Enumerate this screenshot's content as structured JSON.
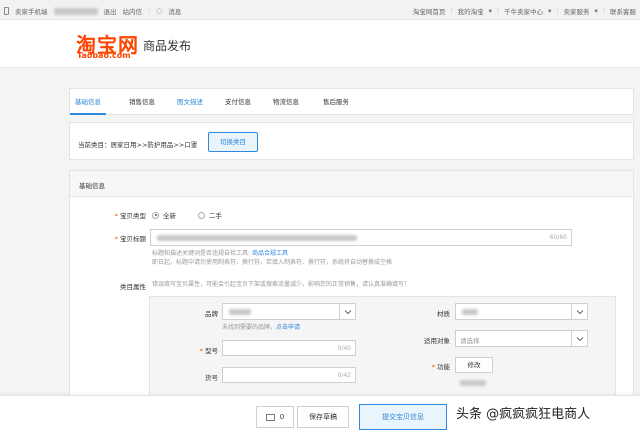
{
  "topbar": {
    "phone_label": "卖家手机端",
    "logout": "退出",
    "inbox": "站内信",
    "messages": "消息",
    "right_links": [
      "淘宝网首页",
      "我的淘宝",
      "千牛卖家中心",
      "卖家服务",
      "联系客服"
    ]
  },
  "header": {
    "logo_cn": "淘宝网",
    "logo_en": "Taobao.com",
    "page_title": "商品发布",
    "logo_color": "#ff4400"
  },
  "tabs": [
    {
      "label": "基础信息",
      "active": true
    },
    {
      "label": "销售信息",
      "active": false
    },
    {
      "label": "图文描述",
      "active": false
    },
    {
      "label": "支付信息",
      "active": false
    },
    {
      "label": "物流信息",
      "active": false
    },
    {
      "label": "售后服务",
      "active": false
    }
  ],
  "category": {
    "current": "当前类目：居家日用>>防护用品>>口罩",
    "switch_button": "切换类目"
  },
  "form": {
    "section_title": "基础信息",
    "item_type": {
      "label": "宝贝类型",
      "options": [
        "全新",
        "二手"
      ],
      "selected": "全新"
    },
    "title_field": {
      "label": "宝贝标题",
      "counter": "60/60",
      "hint_line1": "标题和描述关键词是否违规自检工具:",
      "hint_link": "商品合规工具",
      "hint_line2": "即日起，标题中请勿使用制表符、换行符。若填入制表符、换行符，系统将自动替换成空格"
    },
    "attributes": {
      "label": "类目属性",
      "warning": "错误填写宝贝属性，可能会引起宝贝下架或搜索流量减少，影响您的正常销售，请认真准确填写！",
      "brand_label": "品牌",
      "brand_hint": "未找到需要的品牌，",
      "brand_hint_link": "点击申请",
      "model_label": "型号",
      "model_counter": "0/40",
      "item_no_label": "货号",
      "item_no_counter": "0/42",
      "material_label": "材质",
      "audience_label": "适用对象",
      "audience_placeholder": "请选择",
      "function_label": "功能",
      "function_button": "修改"
    }
  },
  "bottom": {
    "msg_count": "0",
    "save_draft": "保存草稿",
    "submit": "提交宝贝信息",
    "watermark": "头条 @疯疯疯狂电商人"
  },
  "accent_color": "#3089dc"
}
